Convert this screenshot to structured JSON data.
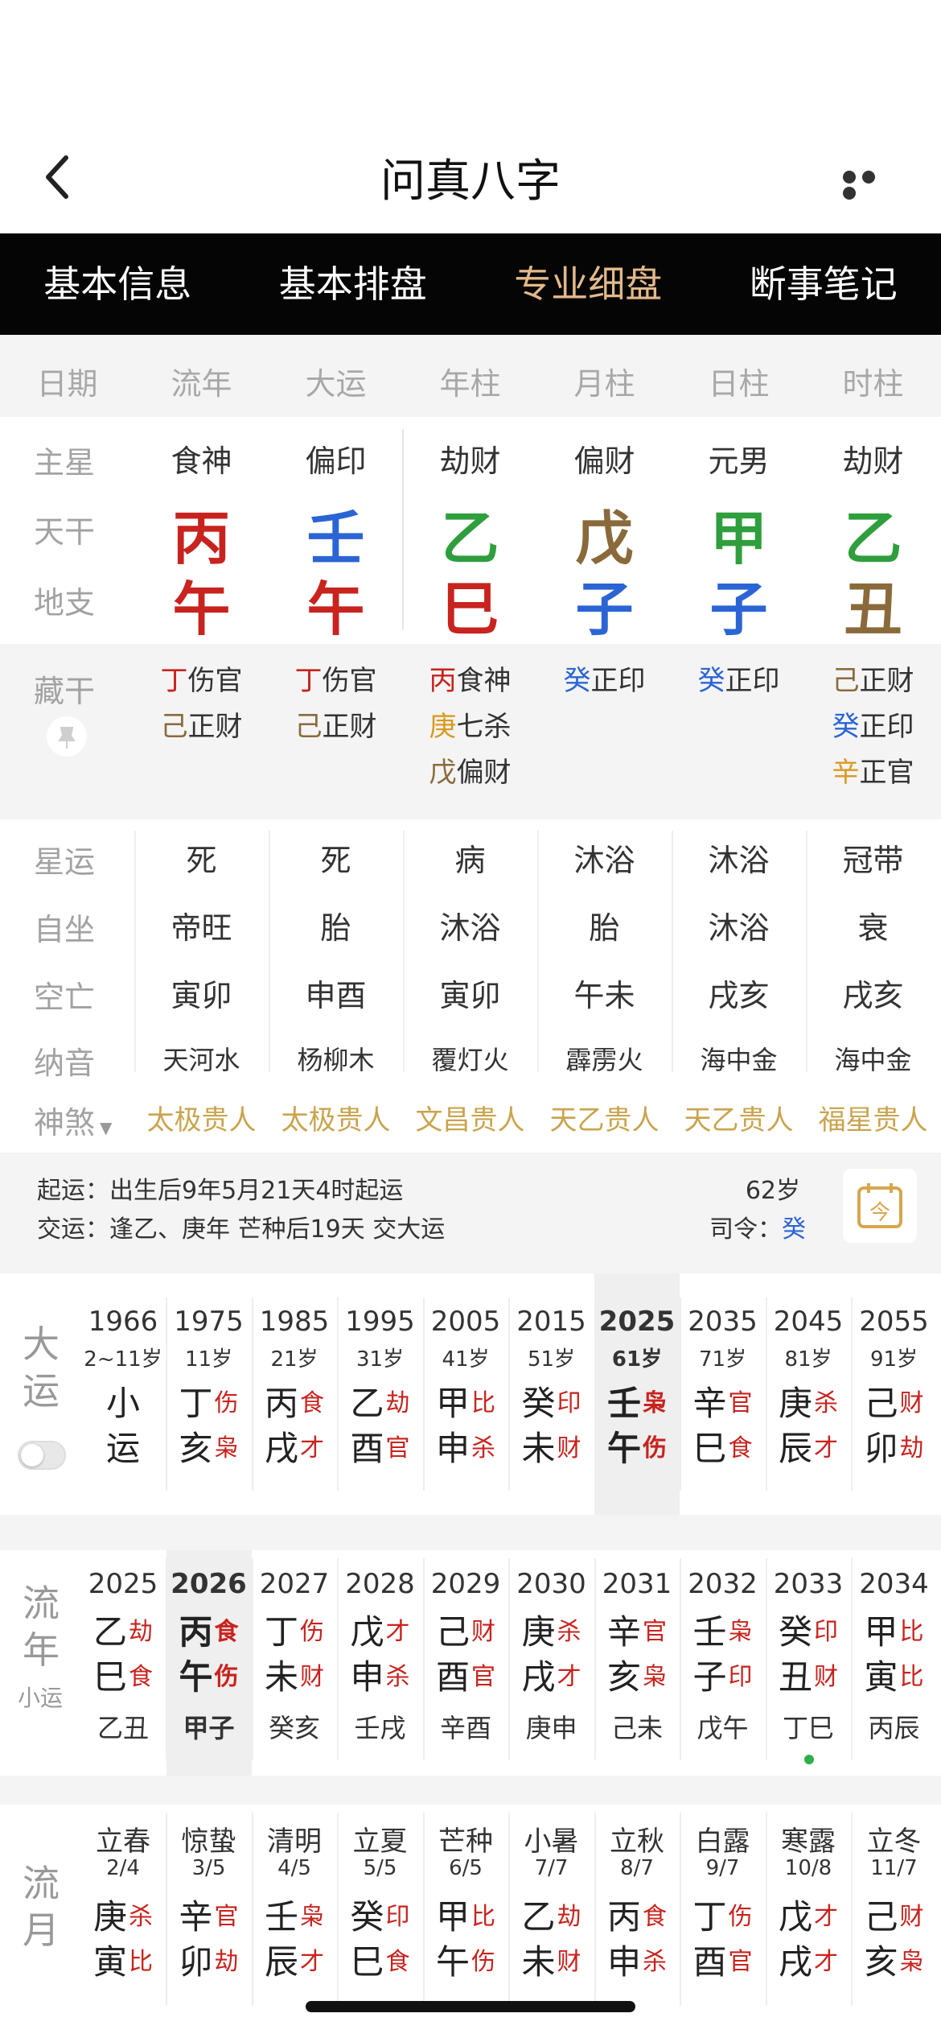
{
  "header": {
    "title": "问真八字"
  },
  "tabs": [
    {
      "label": "基本信息"
    },
    {
      "label": "基本排盘"
    },
    {
      "label": "专业细盘"
    },
    {
      "label": "断事笔记"
    }
  ],
  "active_tab_index": 2,
  "columns": [
    "日期",
    "流年",
    "大运",
    "年柱",
    "月柱",
    "日柱",
    "时柱"
  ],
  "row_labels": {
    "star": "主星",
    "stem": "天干",
    "branch": "地支",
    "hidden": "藏干",
    "stage": "星运",
    "self": "自坐",
    "void": "空亡",
    "nayin": "纳音",
    "gods": "神煞"
  },
  "pillars": [
    {
      "star": "食神",
      "stem": "丙",
      "stem_color": "#c8231e",
      "branch": "午",
      "branch_color": "#c8231e",
      "hidden": [
        {
          "g": "丁",
          "gc": "#c8231e",
          "t": "伤官"
        },
        {
          "g": "己",
          "gc": "#8a6a3b",
          "t": "正财"
        }
      ],
      "stage": "死",
      "self": "帝旺",
      "void": "寅卯",
      "nayin": "天河水",
      "god": "太极贵人"
    },
    {
      "star": "偏印",
      "stem": "壬",
      "stem_color": "#2b64d4",
      "branch": "午",
      "branch_color": "#c8231e",
      "hidden": [
        {
          "g": "丁",
          "gc": "#c8231e",
          "t": "伤官"
        },
        {
          "g": "己",
          "gc": "#8a6a3b",
          "t": "正财"
        }
      ],
      "stage": "死",
      "self": "胎",
      "void": "申酉",
      "nayin": "杨柳木",
      "god": "太极贵人"
    },
    {
      "star": "劫财",
      "stem": "乙",
      "stem_color": "#2f9e3d",
      "branch": "巳",
      "branch_color": "#c8231e",
      "hidden": [
        {
          "g": "丙",
          "gc": "#c8231e",
          "t": "食神"
        },
        {
          "g": "庚",
          "gc": "#d99a1f",
          "t": "七杀"
        },
        {
          "g": "戊",
          "gc": "#8a6a3b",
          "t": "偏财"
        }
      ],
      "stage": "病",
      "self": "沐浴",
      "void": "寅卯",
      "nayin": "覆灯火",
      "god": "文昌贵人"
    },
    {
      "star": "偏财",
      "stem": "戊",
      "stem_color": "#8a6a3b",
      "branch": "子",
      "branch_color": "#2b64d4",
      "hidden": [
        {
          "g": "癸",
          "gc": "#2b64d4",
          "t": "正印"
        }
      ],
      "stage": "沐浴",
      "self": "胎",
      "void": "午未",
      "nayin": "霹雳火",
      "god": "天乙贵人"
    },
    {
      "star": "元男",
      "stem": "甲",
      "stem_color": "#2f9e3d",
      "branch": "子",
      "branch_color": "#2b64d4",
      "hidden": [
        {
          "g": "癸",
          "gc": "#2b64d4",
          "t": "正印"
        }
      ],
      "stage": "沐浴",
      "self": "沐浴",
      "void": "戌亥",
      "nayin": "海中金",
      "god": "天乙贵人"
    },
    {
      "star": "劫财",
      "stem": "乙",
      "stem_color": "#2f9e3d",
      "branch": "丑",
      "branch_color": "#8a6a3b",
      "hidden": [
        {
          "g": "己",
          "gc": "#8a6a3b",
          "t": "正财"
        },
        {
          "g": "癸",
          "gc": "#2b64d4",
          "t": "正印"
        },
        {
          "g": "辛",
          "gc": "#d99a1f",
          "t": "正官"
        }
      ],
      "stage": "冠带",
      "self": "衰",
      "void": "戌亥",
      "nayin": "海中金",
      "god": "福星贵人"
    }
  ],
  "info": {
    "start_luck": "起运：出生后9年5月21天4时起运",
    "change_luck": "交运：逢乙、庚年 芒种后19天 交大运",
    "age": "62岁",
    "commander_label": "司令：",
    "commander": "癸"
  },
  "dayun": {
    "label": [
      "大",
      "运"
    ],
    "items": [
      {
        "year": "1966",
        "age": "2~11岁",
        "top": "小",
        "ts": "",
        "bot": "运",
        "bs": ""
      },
      {
        "year": "1975",
        "age": "11岁",
        "top": "丁",
        "ts": "伤",
        "bot": "亥",
        "bs": "枭"
      },
      {
        "year": "1985",
        "age": "21岁",
        "top": "丙",
        "ts": "食",
        "bot": "戌",
        "bs": "才"
      },
      {
        "year": "1995",
        "age": "31岁",
        "top": "乙",
        "ts": "劫",
        "bot": "酉",
        "bs": "官"
      },
      {
        "year": "2005",
        "age": "41岁",
        "top": "甲",
        "ts": "比",
        "bot": "申",
        "bs": "杀"
      },
      {
        "year": "2015",
        "age": "51岁",
        "top": "癸",
        "ts": "印",
        "bot": "未",
        "bs": "财"
      },
      {
        "year": "2025",
        "age": "61岁",
        "top": "壬",
        "ts": "枭",
        "bot": "午",
        "bs": "伤"
      },
      {
        "year": "2035",
        "age": "71岁",
        "top": "辛",
        "ts": "官",
        "bot": "巳",
        "bs": "食"
      },
      {
        "year": "2045",
        "age": "81岁",
        "top": "庚",
        "ts": "杀",
        "bot": "辰",
        "bs": "才"
      },
      {
        "year": "2055",
        "age": "91岁",
        "top": "己",
        "ts": "财",
        "bot": "卯",
        "bs": "劫"
      }
    ]
  },
  "liunian": {
    "label": [
      "流",
      "年"
    ],
    "sublabel": "小运",
    "items": [
      {
        "year": "2025",
        "top": "乙",
        "ts": "劫",
        "bot": "巳",
        "bs": "食",
        "xy": "乙丑"
      },
      {
        "year": "2026",
        "top": "丙",
        "ts": "食",
        "bot": "午",
        "bs": "伤",
        "xy": "甲子"
      },
      {
        "year": "2027",
        "top": "丁",
        "ts": "伤",
        "bot": "未",
        "bs": "财",
        "xy": "癸亥"
      },
      {
        "year": "2028",
        "top": "戊",
        "ts": "才",
        "bot": "申",
        "bs": "杀",
        "xy": "壬戌"
      },
      {
        "year": "2029",
        "top": "己",
        "ts": "财",
        "bot": "酉",
        "bs": "官",
        "xy": "辛酉"
      },
      {
        "year": "2030",
        "top": "庚",
        "ts": "杀",
        "bot": "戌",
        "bs": "才",
        "xy": "庚申"
      },
      {
        "year": "2031",
        "top": "辛",
        "ts": "官",
        "bot": "亥",
        "bs": "枭",
        "xy": "己未"
      },
      {
        "year": "2032",
        "top": "壬",
        "ts": "枭",
        "bot": "子",
        "bs": "印",
        "xy": "戊午"
      },
      {
        "year": "2033",
        "top": "癸",
        "ts": "印",
        "bot": "丑",
        "bs": "财",
        "xy": "丁巳"
      },
      {
        "year": "2034",
        "top": "甲",
        "ts": "比",
        "bot": "寅",
        "bs": "比",
        "xy": "丙辰"
      }
    ]
  },
  "liuyue": {
    "label": [
      "流",
      "月"
    ],
    "items": [
      {
        "term": "立春",
        "date": "2/4",
        "top": "庚",
        "ts": "杀",
        "bot": "寅",
        "bs": "比"
      },
      {
        "term": "惊蛰",
        "date": "3/5",
        "top": "辛",
        "ts": "官",
        "bot": "卯",
        "bs": "劫"
      },
      {
        "term": "清明",
        "date": "4/5",
        "top": "壬",
        "ts": "枭",
        "bot": "辰",
        "bs": "才"
      },
      {
        "term": "立夏",
        "date": "5/5",
        "top": "癸",
        "ts": "印",
        "bot": "巳",
        "bs": "食"
      },
      {
        "term": "芒种",
        "date": "6/5",
        "top": "甲",
        "ts": "比",
        "bot": "午",
        "bs": "伤"
      },
      {
        "term": "小暑",
        "date": "7/7",
        "top": "乙",
        "ts": "劫",
        "bot": "未",
        "bs": "财"
      },
      {
        "term": "立秋",
        "date": "8/7",
        "top": "丙",
        "ts": "食",
        "bot": "申",
        "bs": "杀"
      },
      {
        "term": "白露",
        "date": "9/7",
        "top": "丁",
        "ts": "伤",
        "bot": "酉",
        "bs": "官"
      },
      {
        "term": "寒露",
        "date": "10/8",
        "top": "戊",
        "ts": "才",
        "bot": "戌",
        "bs": "才"
      },
      {
        "term": "立冬",
        "date": "11/7",
        "top": "己",
        "ts": "财",
        "bot": "亥",
        "bs": "枭"
      }
    ]
  },
  "icons": {
    "back": "chevron-left-icon",
    "more": "more-icon",
    "pin": "pin-icon",
    "calendar": "calendar-today-icon"
  }
}
